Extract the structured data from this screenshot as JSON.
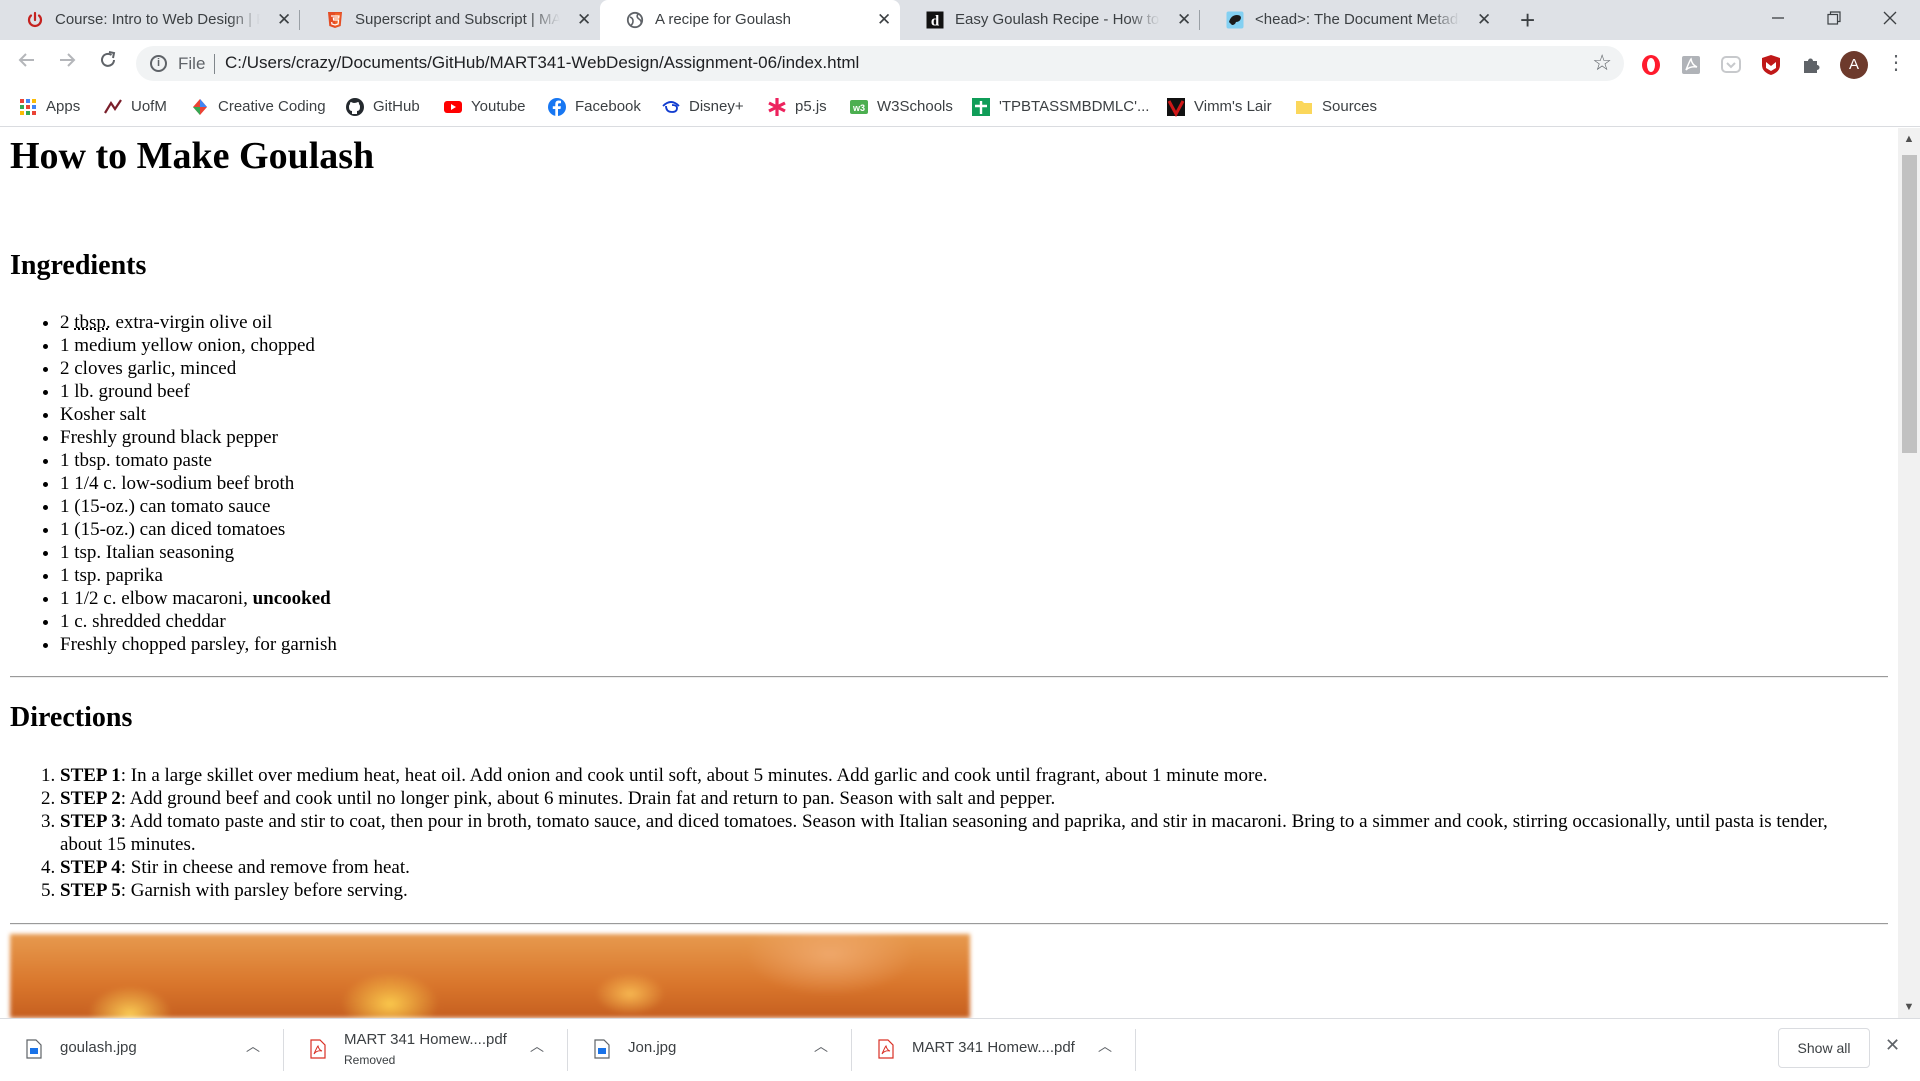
{
  "browser": {
    "tabs": [
      {
        "title": "Course: Intro to Web Design | Fal",
        "icon": "power-icon",
        "active": false
      },
      {
        "title": "Superscript and Subscript | MART",
        "icon": "html5-icon",
        "active": false
      },
      {
        "title": "A recipe for Goulash",
        "icon": "globe-icon",
        "active": true
      },
      {
        "title": "Easy Goulash Recipe - How to Ma",
        "icon": "delish-icon",
        "active": false
      },
      {
        "title": "<head>: The Document Metadat",
        "icon": "mdn-icon",
        "active": false
      }
    ],
    "scheme_label": "File",
    "url": "C:/Users/crazy/Documents/GitHub/MART341-WebDesign/Assignment-06/index.html",
    "profile_initial": "A",
    "bookmarks": [
      {
        "label": "Apps",
        "icon": "apps-grid-icon"
      },
      {
        "label": "UofM",
        "icon": "uofm-icon"
      },
      {
        "label": "Creative Coding",
        "icon": "creative-coding-icon"
      },
      {
        "label": "GitHub",
        "icon": "github-icon"
      },
      {
        "label": "Youtube",
        "icon": "youtube-icon"
      },
      {
        "label": "Facebook",
        "icon": "facebook-icon"
      },
      {
        "label": "Disney+",
        "icon": "disney-icon"
      },
      {
        "label": "p5.js",
        "icon": "p5-icon"
      },
      {
        "label": "W3Schools",
        "icon": "w3schools-icon"
      },
      {
        "label": "'TPBTASSMBDMLC'...",
        "icon": "sheets-icon"
      },
      {
        "label": "Vimm's Lair",
        "icon": "vimm-icon"
      },
      {
        "label": "Sources",
        "icon": "folder-icon"
      }
    ]
  },
  "page": {
    "title": "How to Make Goulash",
    "ingredients_heading": "Ingredients",
    "ingredients": [
      {
        "pre": "2 ",
        "abbr": "tbsp.",
        "text": " extra-virgin olive oil"
      },
      {
        "text": "1 medium yellow onion, chopped"
      },
      {
        "text": "2 cloves garlic, minced"
      },
      {
        "text": "1 lb. ground beef"
      },
      {
        "text": "Kosher salt"
      },
      {
        "text": "Freshly ground black pepper"
      },
      {
        "text": "1 tbsp. tomato paste"
      },
      {
        "text": "1 1/4 c. low-sodium beef broth"
      },
      {
        "text": "1 (15-oz.) can tomato sauce"
      },
      {
        "text": "1 (15-oz.) can diced tomatoes"
      },
      {
        "text": "1 tsp. Italian seasoning"
      },
      {
        "text": "1 tsp. paprika"
      },
      {
        "text": "1 1/2 c. elbow macaroni, ",
        "bold": "uncooked"
      },
      {
        "text": "1 c. shredded cheddar"
      },
      {
        "text": "Freshly chopped parsley, for garnish"
      }
    ],
    "directions_heading": "Directions",
    "directions": [
      {
        "step": "STEP 1",
        "text": ": In a large skillet over medium heat, heat oil. Add onion and cook until soft, about 5 minutes. Add garlic and cook until fragrant, about 1 minute more."
      },
      {
        "step": "STEP 2",
        "text": ": Add ground beef and cook until no longer pink, about 6 minutes. Drain fat and return to pan. Season with salt and pepper."
      },
      {
        "step": "STEP 3",
        "text": ": Add tomato paste and stir to coat, then pour in broth, tomato sauce, and diced tomatoes. Season with Italian seasoning and paprika, and stir in macaroni. Bring to a simmer and cook, stirring occasionally, until pasta is tender, about 15 minutes."
      },
      {
        "step": "STEP 4",
        "text": ": Stir in cheese and remove from heat."
      },
      {
        "step": "STEP 5",
        "text": ": Garnish with parsley before serving."
      }
    ]
  },
  "downloads": {
    "items": [
      {
        "name": "goulash.jpg",
        "status": "",
        "type": "image"
      },
      {
        "name": "MART 341 Homew....pdf",
        "status": "Removed",
        "type": "pdf"
      },
      {
        "name": "Jon.jpg",
        "status": "",
        "type": "image"
      },
      {
        "name": "MART 341 Homew....pdf",
        "status": "",
        "type": "pdf"
      }
    ],
    "show_all_label": "Show all"
  },
  "colors": {
    "tabstrip_bg": "#dee1e6",
    "omnibox_bg": "#f1f3f4",
    "pdf_red": "#d93025",
    "link_blue": "#1a73e8"
  }
}
